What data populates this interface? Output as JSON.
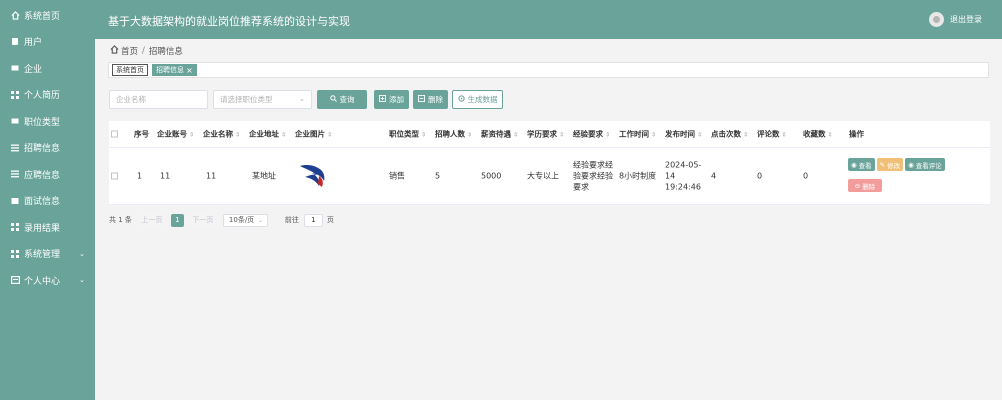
{
  "header": {
    "title": "基于大数据架构的就业岗位推荐系统的设计与实现",
    "logout_label": "退出登录"
  },
  "sidebar": {
    "items": [
      {
        "label": "系统首页",
        "icon": "home-icon"
      },
      {
        "label": "用户",
        "icon": "user-icon"
      },
      {
        "label": "企业",
        "icon": "building-icon"
      },
      {
        "label": "个人简历",
        "icon": "grid-icon"
      },
      {
        "label": "职位类型",
        "icon": "tag-icon"
      },
      {
        "label": "招聘信息",
        "icon": "list-icon",
        "active": true
      },
      {
        "label": "应聘信息",
        "icon": "list-icon"
      },
      {
        "label": "面试信息",
        "icon": "document-icon"
      },
      {
        "label": "录用结果",
        "icon": "grid-icon"
      },
      {
        "label": "系统管理",
        "icon": "grid-icon",
        "has_arrow": true
      },
      {
        "label": "个人中心",
        "icon": "id-card-icon",
        "has_arrow": true
      }
    ]
  },
  "breadcrumb": {
    "home": "首页",
    "separator": "/",
    "current": "招聘信息"
  },
  "tags": {
    "home": "系统首页",
    "current": "招聘信息",
    "close": "×"
  },
  "filters": {
    "company_name_placeholder": "企业名称",
    "job_type_placeholder": "请选择职位类型",
    "search_label": "查询",
    "add_label": "添加",
    "delete_label": "删除",
    "report_label": "生成数据"
  },
  "table": {
    "headers": [
      "序号",
      "企业账号",
      "企业名称",
      "企业地址",
      "企业图片",
      "职位类型",
      "招聘人数",
      "薪资待遇",
      "学历要求",
      "经验要求",
      "工作时间",
      "发布时间",
      "点击次数",
      "评论数",
      "收藏数",
      "操作"
    ],
    "rows": [
      {
        "index": "1",
        "account": "11",
        "name": "11",
        "address": "某地址",
        "job_type": "销售",
        "headcount": "5",
        "salary": "5000",
        "education": "大专以上",
        "experience": "经验要求经验要求经验要求",
        "work_time": "8小时制度",
        "publish_time": "2024-05-14 19:24:46",
        "clicks": "4",
        "comments": "0",
        "favorites": "0"
      }
    ],
    "actions": {
      "view": "查看",
      "edit": "修改",
      "view_comments": "查看评论",
      "delete": "删除"
    }
  },
  "pagination": {
    "total": "共 1 条",
    "prev": "上一页",
    "current_page": "1",
    "next": "下一页",
    "page_size": "10条/页",
    "goto_label": "前往",
    "goto_value": "1",
    "page_unit": "页"
  },
  "colors": {
    "primary": "#6aa39a",
    "edit": "#f0c078",
    "delete": "#f29c9c"
  }
}
